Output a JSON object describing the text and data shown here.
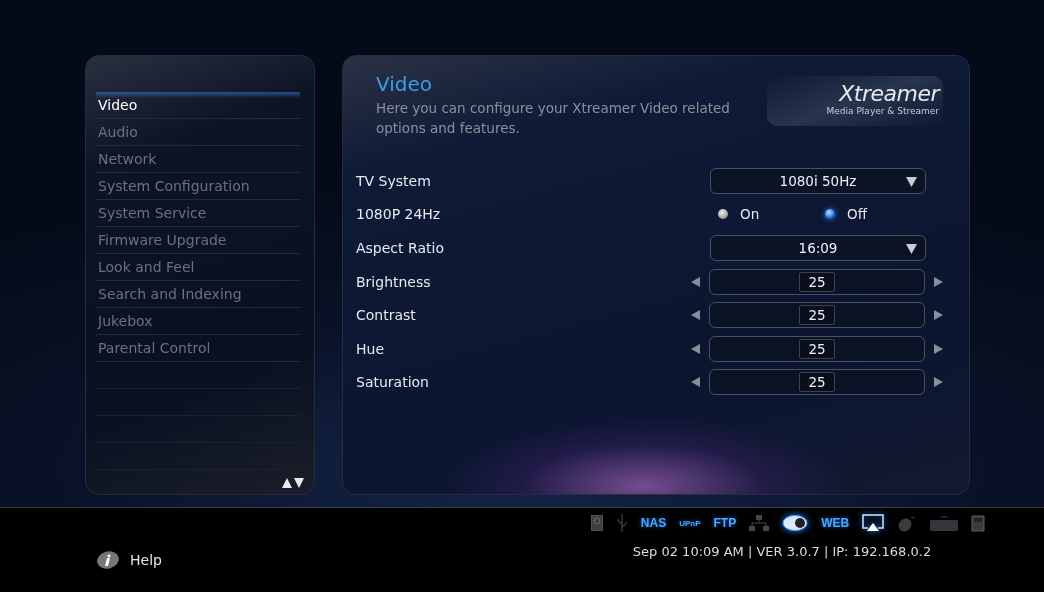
{
  "sidebar": {
    "items": [
      {
        "label": "Video",
        "selected": true
      },
      {
        "label": "Audio",
        "selected": false
      },
      {
        "label": "Network",
        "selected": false
      },
      {
        "label": "System Configuration",
        "selected": false
      },
      {
        "label": "System Service",
        "selected": false
      },
      {
        "label": "Firmware Upgrade",
        "selected": false
      },
      {
        "label": "Look and Feel",
        "selected": false
      },
      {
        "label": "Search and Indexing",
        "selected": false
      },
      {
        "label": "Jukebox",
        "selected": false
      },
      {
        "label": "Parental Control",
        "selected": false
      }
    ]
  },
  "panel": {
    "title": "Video",
    "description": "Here you can configure your Xtreamer Video related options and features.",
    "logo": {
      "name": "Xtreamer",
      "tagline": "Media Player & Streamer"
    },
    "settings": [
      {
        "kind": "dropdown",
        "label": "TV System",
        "value": "1080i 50Hz"
      },
      {
        "kind": "radio",
        "label": "1080P 24Hz",
        "options": [
          {
            "label": "On",
            "selected": false
          },
          {
            "label": "Off",
            "selected": true
          }
        ]
      },
      {
        "kind": "dropdown",
        "label": "Aspect Ratio",
        "value": "16:09"
      },
      {
        "kind": "spinner",
        "label": "Brightness",
        "value": "25"
      },
      {
        "kind": "spinner",
        "label": "Contrast",
        "value": "25"
      },
      {
        "kind": "spinner",
        "label": "Hue",
        "value": "25"
      },
      {
        "kind": "spinner",
        "label": "Saturation",
        "value": "25"
      }
    ]
  },
  "footer": {
    "help": "Help",
    "status_icons": [
      {
        "kind": "icon",
        "active": false
      },
      {
        "kind": "icon",
        "active": false
      },
      {
        "kind": "label",
        "label": "NAS",
        "active": true
      },
      {
        "kind": "label",
        "label": "UPnP",
        "active": true
      },
      {
        "kind": "label",
        "label": "FTP",
        "active": true
      },
      {
        "kind": "icon",
        "active": false
      },
      {
        "kind": "icon",
        "active": true
      },
      {
        "kind": "label",
        "label": "WEB",
        "active": true
      },
      {
        "kind": "icon",
        "active": true
      },
      {
        "kind": "icon",
        "active": false
      },
      {
        "kind": "icon",
        "active": false
      },
      {
        "kind": "icon",
        "active": false
      }
    ],
    "status_text": "Sep 02 10:09 AM | VER 3.0.7 | IP: 192.168.0.2"
  }
}
